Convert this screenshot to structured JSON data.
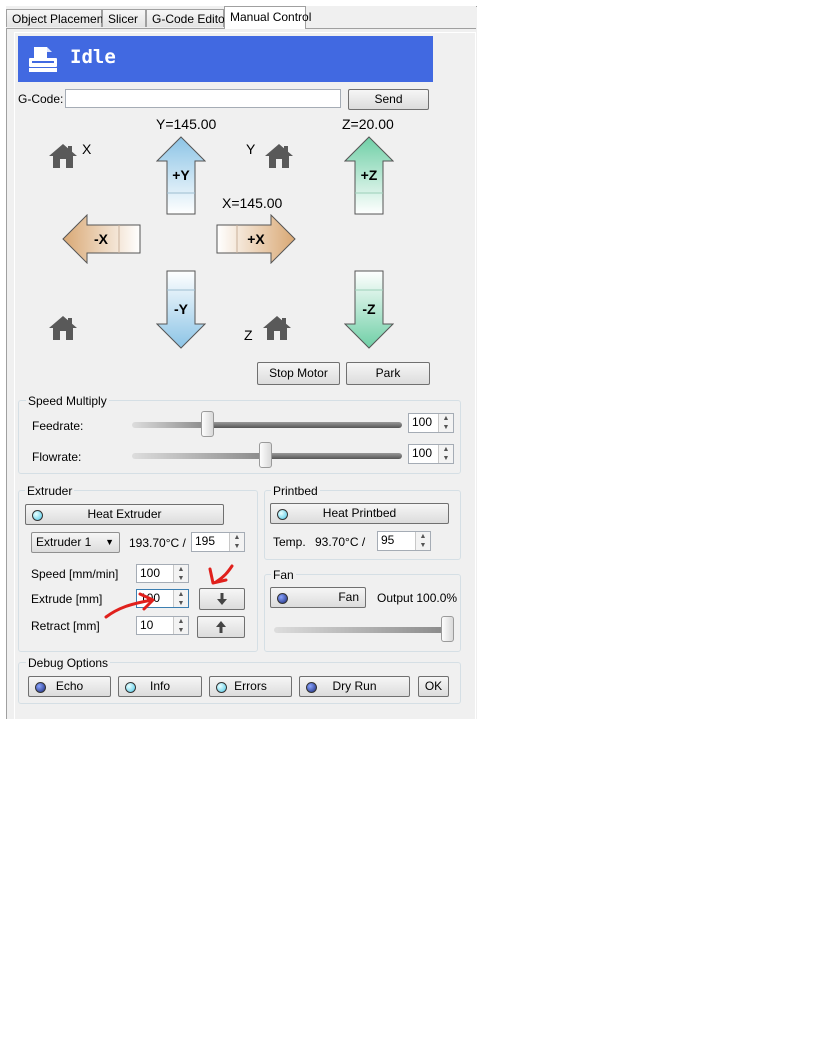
{
  "tabs": [
    "Object Placement",
    "Slicer",
    "G-Code Editor",
    "Manual Control"
  ],
  "status": {
    "text": "Idle"
  },
  "gcode": {
    "label": "G-Code:",
    "value": "",
    "send_label": "Send"
  },
  "positions": {
    "x": "X=145.00",
    "y": "Y=145.00",
    "z": "Z=20.00"
  },
  "home": {
    "x_label": "X",
    "y_label": "Y",
    "z_label": "Z"
  },
  "jog": {
    "plus_y": "+Y",
    "minus_y": "-Y",
    "plus_x": "+X",
    "minus_x": "-X",
    "plus_z": "+Z",
    "minus_z": "-Z"
  },
  "motion_buttons": {
    "stop_motor": "Stop Motor",
    "park": "Park"
  },
  "speed_multiply": {
    "title": "Speed Multiply",
    "feedrate_label": "Feedrate:",
    "feedrate_value": "100",
    "feedrate_fraction": 0.27,
    "flowrate_label": "Flowrate:",
    "flowrate_value": "100",
    "flowrate_fraction": 0.5
  },
  "extruder": {
    "title": "Extruder",
    "heat_label": "Heat Extruder",
    "selected": "Extruder 1",
    "temp_text": "193.70°C /",
    "target": "195",
    "speed_label": "Speed [mm/min]",
    "speed_value": "100",
    "extrude_label": "Extrude [mm]",
    "extrude_value": "100",
    "retract_label": "Retract [mm]",
    "retract_value": "10"
  },
  "printbed": {
    "title": "Printbed",
    "heat_label": "Heat Printbed",
    "temp_label": "Temp.",
    "temp_text": "93.70°C /",
    "target": "95"
  },
  "fan": {
    "title": "Fan",
    "button_label": "Fan",
    "output_text": "Output 100.0%",
    "output_fraction": 1.0
  },
  "debug": {
    "title": "Debug Options",
    "echo": "Echo",
    "info": "Info",
    "errors": "Errors",
    "dry_run": "Dry Run",
    "ok": "OK"
  },
  "colors": {
    "status_bg": "#4169e1",
    "annotation": "#e0201c",
    "y_arrow": "#a8d4ee",
    "x_arrow": "#e8c9a4",
    "z_arrow": "#8fdcbc"
  }
}
